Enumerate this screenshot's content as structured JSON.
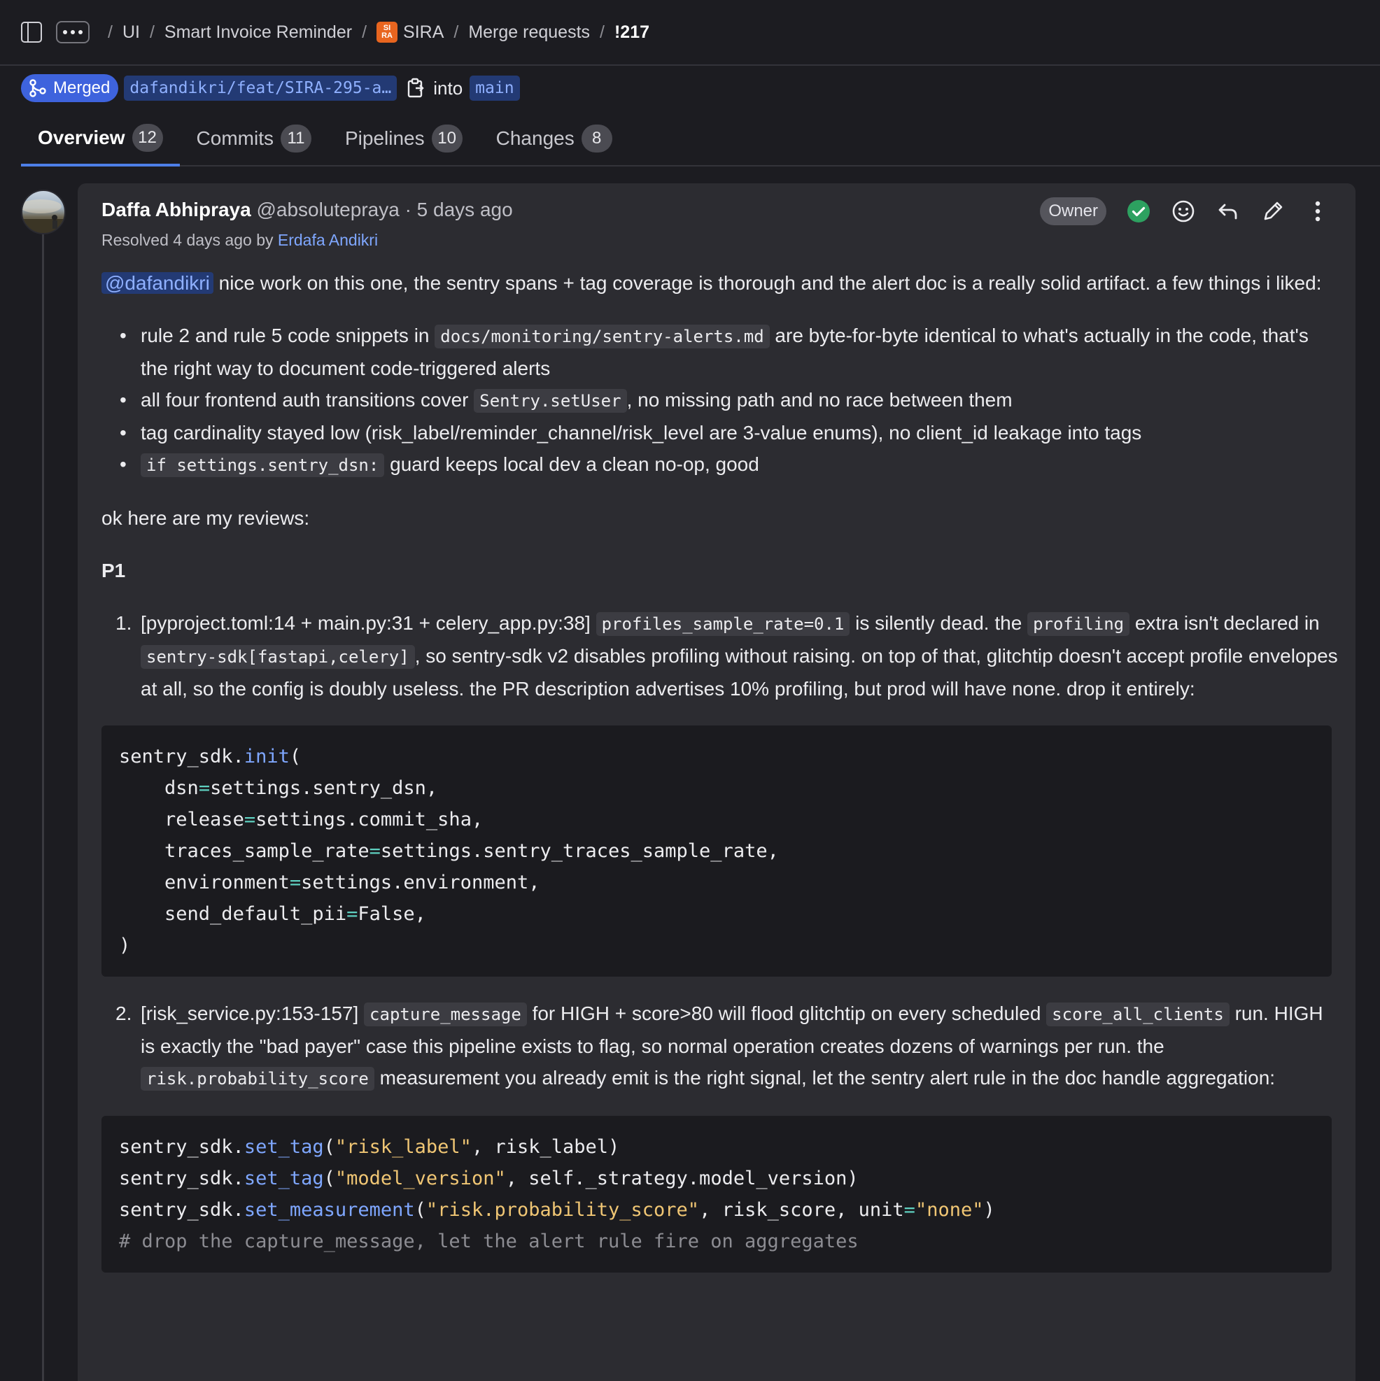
{
  "breadcrumb": {
    "items": [
      "UI",
      "Smart Invoice Reminder",
      "SIRA",
      "Merge requests"
    ],
    "current": "!217",
    "project_avatar_text": "SIRA"
  },
  "status": {
    "state": "Merged",
    "source_branch": "dafandikri/feat/SIRA-295-a…",
    "into": "into",
    "target_branch": "main"
  },
  "tabs": [
    {
      "label": "Overview",
      "count": "12"
    },
    {
      "label": "Commits",
      "count": "11"
    },
    {
      "label": "Pipelines",
      "count": "10"
    },
    {
      "label": "Changes",
      "count": "8"
    }
  ],
  "note": {
    "author": "Daffa Abhipraya",
    "handle": "@absolutepraya",
    "time": "· 5 days ago",
    "resolved_prefix": "Resolved 4 days ago by",
    "resolved_by": "Erdafa Andikri",
    "role_badge": "Owner",
    "intro_mention": "@dafandikri",
    "intro_text": " nice work on this one, the sentry spans + tag coverage is thorough and the alert doc is a really solid artifact. a few things i liked:",
    "likes": [
      {
        "pre": "rule 2 and rule 5 code snippets in ",
        "code": "docs/monitoring/sentry-alerts.md",
        "post": " are byte-for-byte identical to what's actually in the code, that's the right way to document code-triggered alerts"
      },
      {
        "pre": "all four frontend auth transitions cover ",
        "code": "Sentry.setUser",
        "post": ", no missing path and no race between them"
      },
      {
        "pre": "tag cardinality stayed low (risk_label/reminder_channel/risk_level are 3-value enums), no client_id leakage into tags",
        "code": "",
        "post": ""
      },
      {
        "pre": "",
        "code": "if settings.sentry_dsn:",
        "post": " guard keeps local dev a clean no-op, good"
      }
    ],
    "reviews_intro": "ok here are my reviews:",
    "priority_heading": "P1",
    "review1": {
      "num": "1.",
      "t1": "[pyproject.toml:14 + main.py:31 + celery_app.py:38] ",
      "c1": "profiles_sample_rate=0.1",
      "t2": " is silently dead. the ",
      "c2": "profiling",
      "t3": " extra isn't declared in ",
      "c3": "sentry-sdk[fastapi,celery]",
      "t4": ", so sentry-sdk v2 disables profiling without raising. on top of that, glitchtip doesn't accept profile envelopes at all, so the config is doubly useless. the PR description advertises 10% profiling, but prod will have none. drop it entirely:"
    },
    "code1": {
      "obj": "sentry_sdk.",
      "fn": "init",
      "open": "(",
      "args": [
        {
          "k": "dsn",
          "v": "settings.sentry_dsn,"
        },
        {
          "k": "release",
          "v": "settings.commit_sha,"
        },
        {
          "k": "traces_sample_rate",
          "v": "settings.sentry_traces_sample_rate,"
        },
        {
          "k": "environment",
          "v": "settings.environment,"
        },
        {
          "k": "send_default_pii",
          "v": "False,"
        }
      ],
      "close": ")"
    },
    "review2": {
      "num": "2.",
      "t1": "[risk_service.py:153-157] ",
      "c1": "capture_message",
      "t2": " for HIGH + score>80 will flood glitchtip on every scheduled ",
      "c2": "score_all_clients",
      "t3": " run. HIGH is exactly the \"bad payer\" case this pipeline exists to flag, so normal operation creates dozens of warnings per run. the ",
      "c3": "risk.probability_score",
      "t4": " measurement you already emit is the right signal, let the sentry alert rule in the doc handle aggregation:"
    },
    "code2": {
      "l1_obj": "sentry_sdk.",
      "l1_fn": "set_tag",
      "l1_str": "\"risk_label\"",
      "l1_rest": ", risk_label)",
      "l2_obj": "sentry_sdk.",
      "l2_fn": "set_tag",
      "l2_str": "\"model_version\"",
      "l2_rest": ", self._strategy.model_version)",
      "l3_obj": "sentry_sdk.",
      "l3_fn": "set_measurement",
      "l3_str": "\"risk.probability_score\"",
      "l3_mid": ", risk_score, unit",
      "l3_str2": "\"none\"",
      "l3_rest": ")",
      "comment": "# drop the capture_message, let the alert rule fire on aggregates"
    }
  }
}
